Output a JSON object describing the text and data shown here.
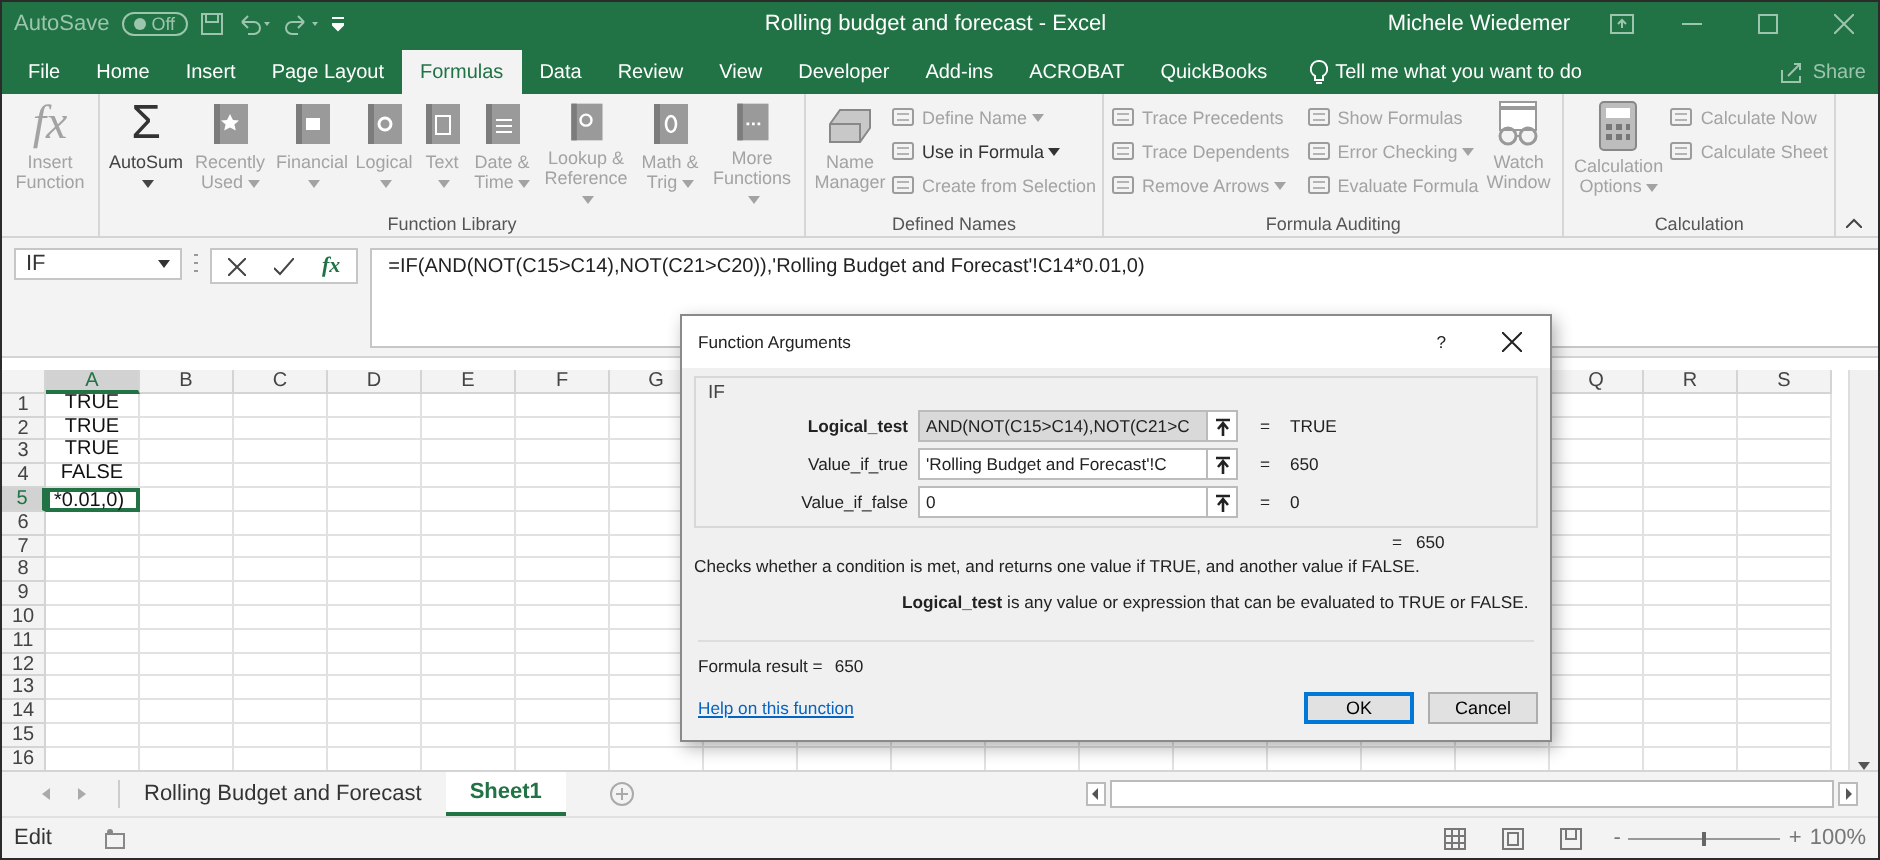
{
  "title_bar": {
    "autosave": {
      "label": "AutoSave",
      "toggle": "Off",
      "on": false
    },
    "title": "Rolling budget and forecast  -  Excel",
    "user": "Michele Wiedemer"
  },
  "tabs": [
    {
      "label": "File",
      "selected": false
    },
    {
      "label": "Home",
      "selected": false
    },
    {
      "label": "Insert",
      "selected": false
    },
    {
      "label": "Page Layout",
      "selected": false
    },
    {
      "label": "Formulas",
      "selected": true
    },
    {
      "label": "Data",
      "selected": false
    },
    {
      "label": "Review",
      "selected": false
    },
    {
      "label": "View",
      "selected": false
    },
    {
      "label": "Developer",
      "selected": false
    },
    {
      "label": "Add-ins",
      "selected": false
    },
    {
      "label": "ACROBAT",
      "selected": false
    },
    {
      "label": "QuickBooks",
      "selected": false
    }
  ],
  "tell_me": "Tell me what you want to do",
  "share": "Share",
  "ribbon": {
    "groups": [
      {
        "large": [
          {
            "label": "Insert Function",
            "glyph": "fx",
            "disabled": true,
            "menu": false
          }
        ]
      },
      {
        "label": "Function Library",
        "large": [
          {
            "label": "AutoSum",
            "glyph": "Σ",
            "disabled": false,
            "menu": true
          },
          {
            "label": "Recently Used",
            "disabled": true,
            "menu": true
          },
          {
            "label": "Financial",
            "disabled": true,
            "menu": true
          },
          {
            "label": "Logical",
            "disabled": true,
            "menu": true
          },
          {
            "label": "Text",
            "disabled": true,
            "menu": true
          },
          {
            "label": "Date & Time",
            "disabled": true,
            "menu": true
          },
          {
            "label": "Lookup & Reference",
            "disabled": true,
            "menu": true
          },
          {
            "label": "Math & Trig",
            "disabled": true,
            "menu": true
          },
          {
            "label": "More Functions",
            "disabled": true,
            "menu": true
          }
        ]
      },
      {
        "label": "Defined Names",
        "large": [
          {
            "label": "Name Manager",
            "disabled": true,
            "menu": false
          }
        ],
        "small": [
          {
            "label": "Define Name",
            "disabled": true,
            "menu": true
          },
          {
            "label": "Use in Formula",
            "disabled": false,
            "menu": true
          },
          {
            "label": "Create from Selection",
            "disabled": true,
            "menu": false
          }
        ]
      },
      {
        "label": "Formula Auditing",
        "small": [
          {
            "label": "Trace Precedents",
            "disabled": true,
            "menu": false
          },
          {
            "label": "Trace Dependents",
            "disabled": true,
            "menu": false
          },
          {
            "label": "Remove Arrows",
            "disabled": true,
            "menu": true
          },
          {
            "label": "Show Formulas",
            "disabled": true,
            "menu": false
          },
          {
            "label": "Error Checking",
            "disabled": true,
            "menu": true
          },
          {
            "label": "Evaluate Formula",
            "disabled": true,
            "menu": false
          }
        ],
        "large_after": [
          {
            "label": "Watch Window",
            "disabled": true,
            "menu": false
          }
        ]
      },
      {
        "label": "Calculation",
        "large": [
          {
            "label": "Calculation Options",
            "disabled": true,
            "menu": true
          }
        ],
        "small": [
          {
            "label": "Calculate Now",
            "disabled": true,
            "menu": false
          },
          {
            "label": "Calculate Sheet",
            "disabled": true,
            "menu": false
          }
        ]
      }
    ]
  },
  "formula_bar": {
    "name_box": "IF",
    "fx": "fx",
    "formula": "=IF(AND(NOT(C15>C14),NOT(C21>C20)),'Rolling Budget and Forecast'!C14*0.01,0)"
  },
  "grid": {
    "columns": [
      {
        "letter": "A",
        "selected": true
      },
      {
        "letter": "B",
        "selected": false
      },
      {
        "letter": "C",
        "selected": false
      },
      {
        "letter": "D",
        "selected": false
      },
      {
        "letter": "E",
        "selected": false
      },
      {
        "letter": "F",
        "selected": false
      },
      {
        "letter": "G",
        "selected": false
      }
    ],
    "columns_right": [
      {
        "letter": "Q",
        "selected": false
      },
      {
        "letter": "R",
        "selected": false
      },
      {
        "letter": "S",
        "selected": false
      }
    ],
    "rows": [
      {
        "number": "1",
        "selected": false,
        "cells": [
          {
            "value": "TRUE",
            "selected": false,
            "kind": "boolean"
          }
        ]
      },
      {
        "number": "2",
        "selected": false,
        "cells": [
          {
            "value": "TRUE",
            "selected": false,
            "kind": "boolean"
          }
        ]
      },
      {
        "number": "3",
        "selected": false,
        "cells": [
          {
            "value": "TRUE",
            "selected": false,
            "kind": "boolean"
          }
        ]
      },
      {
        "number": "4",
        "selected": false,
        "cells": [
          {
            "value": "FALSE",
            "selected": false,
            "kind": "boolean"
          }
        ]
      },
      {
        "number": "5",
        "selected": true,
        "cells": [
          {
            "value": "*0.01,0)",
            "selected": true,
            "kind": "text"
          }
        ]
      },
      {
        "number": "6",
        "selected": false,
        "cells": []
      },
      {
        "number": "7",
        "selected": false,
        "cells": []
      },
      {
        "number": "8",
        "selected": false,
        "cells": []
      },
      {
        "number": "9",
        "selected": false,
        "cells": []
      },
      {
        "number": "10",
        "selected": false,
        "cells": []
      },
      {
        "number": "11",
        "selected": false,
        "cells": []
      },
      {
        "number": "12",
        "selected": false,
        "cells": []
      },
      {
        "number": "13",
        "selected": false,
        "cells": []
      },
      {
        "number": "14",
        "selected": false,
        "cells": []
      },
      {
        "number": "15",
        "selected": false,
        "cells": []
      },
      {
        "number": "16",
        "selected": false,
        "cells": []
      }
    ]
  },
  "sheets": [
    {
      "label": "Rolling Budget and Forecast",
      "selected": false
    },
    {
      "label": "Sheet1",
      "selected": true
    }
  ],
  "status_bar": {
    "mode": "Edit",
    "zoom_out": "-",
    "zoom_in": "+",
    "zoom": "100%",
    "level": 0.5
  },
  "dialog": {
    "title": "Function Arguments",
    "help": "?",
    "function": "IF",
    "args": [
      {
        "label": "Logical_test",
        "value": "AND(NOT(C15>C14),NOT(C21>C",
        "equals": "=",
        "result": "TRUE",
        "selected": true
      },
      {
        "label": "Value_if_true",
        "value": "'Rolling Budget and Forecast'!C",
        "equals": "=",
        "result": "650",
        "selected": false
      },
      {
        "label": "Value_if_false",
        "value": "0",
        "equals": "=",
        "result": "0",
        "selected": false
      }
    ],
    "total_equals": "=",
    "total": "650",
    "description": "Checks whether a condition is met, and returns one value if TRUE, and another value if FALSE.",
    "arg_help": "**Logical_test**   is any value or expression that can be evaluated to TRUE or FALSE.",
    "result_label": "Formula result =",
    "result": "650",
    "link": "Help on this function",
    "buttons": [
      {
        "label": "OK",
        "default": true
      },
      {
        "label": "Cancel",
        "default": false
      }
    ]
  }
}
